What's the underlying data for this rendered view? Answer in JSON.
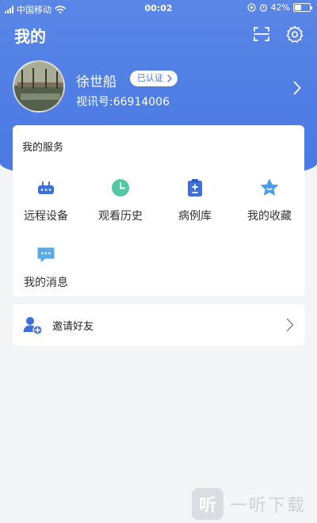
{
  "status_bar": {
    "carrier": "中国移动",
    "time": "00:02",
    "battery": "42%",
    "battery_level": 0.42
  },
  "header": {
    "title": "我的",
    "icons": [
      "scan-icon",
      "gear-icon"
    ]
  },
  "profile": {
    "name": "徐世船",
    "badge": "已认证",
    "id_text": "视讯号:66914006"
  },
  "services": {
    "title": "我的服务",
    "items": [
      {
        "label": "远程设备",
        "icon": "router-icon",
        "color": "#3f6fd8"
      },
      {
        "label": "观看历史",
        "icon": "clock-icon",
        "color": "#52c9a4"
      },
      {
        "label": "病例库",
        "icon": "clipboard-icon",
        "color": "#3f6fd8"
      },
      {
        "label": "我的收藏",
        "icon": "star-icon",
        "color": "#4a9be8"
      },
      {
        "label": "我的消息",
        "icon": "message-icon",
        "color": "#5aa8e6"
      }
    ]
  },
  "invite": {
    "label": "邀请好友",
    "icon": "add-user-icon"
  },
  "watermark": {
    "logo_char": "听",
    "text": "一听下载"
  },
  "colors": {
    "primary": "#4e7de4",
    "background": "#f4f5f7"
  }
}
